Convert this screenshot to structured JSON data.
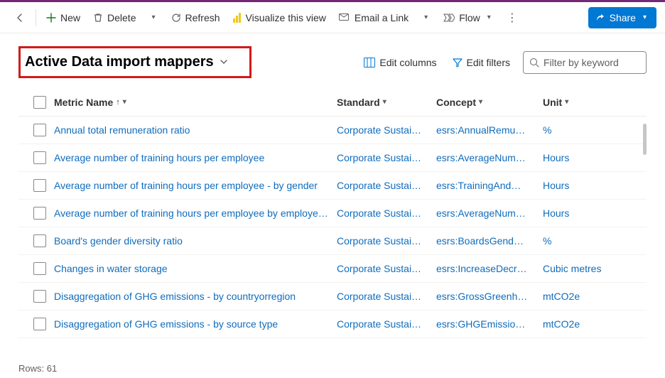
{
  "colors": {
    "accent": "#0078d4",
    "purple": "#742774",
    "redHighlight": "#d21a1a",
    "link": "#0f6cbd"
  },
  "commandBar": {
    "new": "New",
    "delete": "Delete",
    "refresh": "Refresh",
    "visualize": "Visualize this view",
    "emailLink": "Email a Link",
    "flow": "Flow",
    "share": "Share"
  },
  "view": {
    "title": "Active Data import mappers",
    "editColumns": "Edit columns",
    "editFilters": "Edit filters",
    "searchPlaceholder": "Filter by keyword"
  },
  "columns": {
    "metricName": "Metric Name",
    "standard": "Standard",
    "concept": "Concept",
    "unit": "Unit"
  },
  "rows": [
    {
      "name": "Annual total remuneration ratio",
      "standard": "Corporate Sustai…",
      "concept": "esrs:AnnualRemu…",
      "unit": "%"
    },
    {
      "name": "Average number of training hours per employee",
      "standard": "Corporate Sustai…",
      "concept": "esrs:AverageNum…",
      "unit": "Hours"
    },
    {
      "name": "Average number of training hours per employee - by gender",
      "standard": "Corporate Sustai…",
      "concept": "esrs:TrainingAnd…",
      "unit": "Hours"
    },
    {
      "name": "Average number of training hours per employee by employee ca…",
      "standard": "Corporate Sustai…",
      "concept": "esrs:AverageNum…",
      "unit": "Hours"
    },
    {
      "name": "Board's gender diversity ratio",
      "standard": "Corporate Sustai…",
      "concept": "esrs:BoardsGend…",
      "unit": "%"
    },
    {
      "name": "Changes in water storage",
      "standard": "Corporate Sustai…",
      "concept": "esrs:IncreaseDecr…",
      "unit": "Cubic metres"
    },
    {
      "name": "Disaggregation of GHG emissions - by countryorregion",
      "standard": "Corporate Sustai…",
      "concept": "esrs:GrossGreenh…",
      "unit": "mtCO2e"
    },
    {
      "name": "Disaggregation of GHG emissions - by source type",
      "standard": "Corporate Sustai…",
      "concept": "esrs:GHGEmissio…",
      "unit": "mtCO2e"
    }
  ],
  "footer": {
    "rowsLabel": "Rows: 61"
  }
}
